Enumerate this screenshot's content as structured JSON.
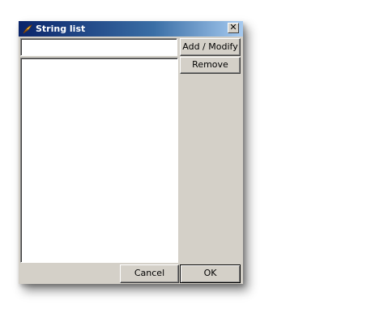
{
  "window": {
    "title": "String list",
    "close_symbol": "✕"
  },
  "input": {
    "value": "",
    "placeholder": ""
  },
  "list": {
    "items": []
  },
  "buttons": {
    "add_modify": "Add / Modify",
    "remove": "Remove",
    "cancel": "Cancel",
    "ok": "OK"
  },
  "icons": {
    "title_icon": "app-feather-icon"
  },
  "colors": {
    "titlebar_start": "#0a246a",
    "titlebar_end": "#a6caf0",
    "dialog_face": "#d4d0c8"
  }
}
